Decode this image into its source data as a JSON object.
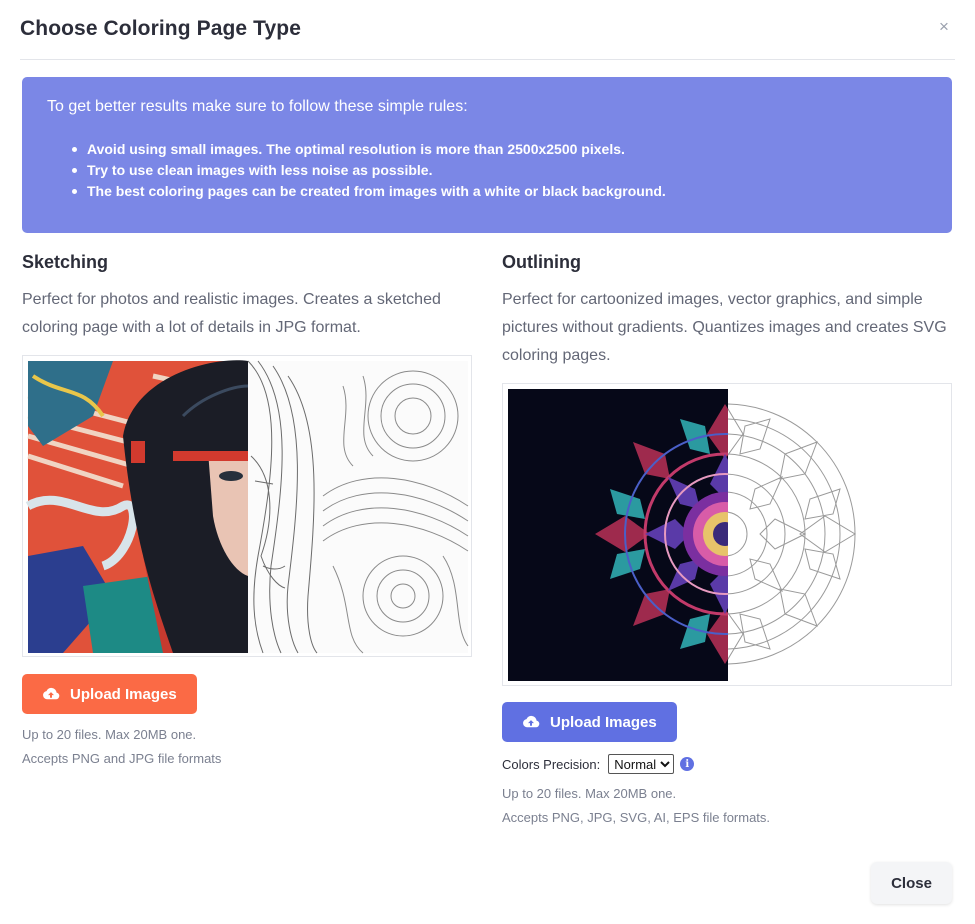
{
  "modal": {
    "title": "Choose Coloring Page Type",
    "close_symbol": "×"
  },
  "rules": {
    "intro": "To get better results make sure to follow these simple rules:",
    "items": [
      "Avoid using small images. The optimal resolution is more than 2500x2500 pixels.",
      "Try to use clean images with less noise as possible.",
      "The best coloring pages can be created from images with a white or black background."
    ],
    "background_color": "#7b87e6"
  },
  "sketching": {
    "heading": "Sketching",
    "description": "Perfect for photos and realistic images. Creates a sketched coloring page with a lot of details in JPG format.",
    "upload_label": "Upload Images",
    "upload_icon": "cloud-upload-icon",
    "button_color": "#fb6a45",
    "notes": [
      "Up to 20 files. Max 20MB one.",
      "Accepts PNG and JPG file formats"
    ]
  },
  "outlining": {
    "heading": "Outlining",
    "description": "Perfect for cartoonized images, vector graphics, and simple pictures without gradients. Quantizes images and creates SVG coloring pages.",
    "upload_label": "Upload Images",
    "upload_icon": "cloud-upload-icon",
    "button_color": "#6070e2",
    "precision_label": "Colors Precision:",
    "precision_value": "Normal",
    "info_icon": "info-icon",
    "info_symbol": "i",
    "notes": [
      "Up to 20 files. Max 20MB one.",
      "Accepts PNG, JPG, SVG, AI, EPS file formats."
    ]
  },
  "footer": {
    "close_label": "Close"
  }
}
